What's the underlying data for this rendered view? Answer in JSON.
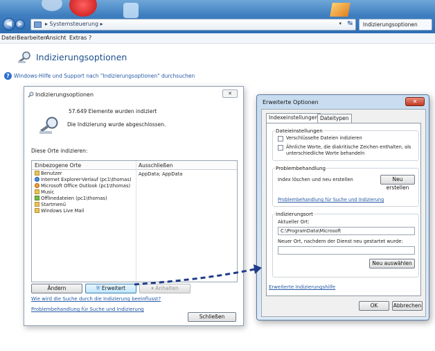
{
  "window": {
    "address_crumb": "▸ Systemsteuerung ▸",
    "search_text": "Indizierungsoptionen"
  },
  "menubar": {
    "items": [
      "Datei",
      "Bearbeiten",
      "Ansicht",
      "Extras",
      "?"
    ]
  },
  "page": {
    "heading": "Indizierungsoptionen",
    "help_link": "Windows-Hilfe und Support nach \"Indizierungsoptionen\" durchsuchen"
  },
  "dialog_indexing": {
    "title": "Indizierungsoptionen",
    "close_label": "✕",
    "count_text": "57.649 Elemente wurden indiziert",
    "status_text": "Die Indizierung wurde abgeschlossen.",
    "locations_label": "Diese Orte indizieren:",
    "col_included": "Einbezogene Orte",
    "col_excluded": "Ausschließen",
    "rows": [
      {
        "icon": "folder-icon",
        "label": "Benutzer",
        "excluded": "AppData; AppData"
      },
      {
        "icon": "internet-explorer-icon",
        "label": "Internet Explorer-Verlauf (pc1\\thomas)"
      },
      {
        "icon": "outlook-icon",
        "label": "Microsoft Office Outlook (pc1\\thomas)"
      },
      {
        "icon": "folder-icon",
        "label": "Music"
      },
      {
        "icon": "sync-icon",
        "label": "Offlinedateien (pc1\\thomas)"
      },
      {
        "icon": "folder-icon",
        "label": "Startmenü"
      },
      {
        "icon": "folder-icon",
        "label": "Windows Live Mail"
      }
    ],
    "btn_change": "Ändern",
    "btn_advanced": "Erweitert",
    "btn_pause": "Anhalten",
    "link_search_influence": "Wie wird die Suche durch die Indizierung beeinflusst?",
    "link_troubleshoot": "Problembehandlung für Suche und Indizierung",
    "btn_close": "Schließen"
  },
  "dialog_advanced": {
    "title": "Erweiterte Optionen",
    "close_label": "✕",
    "tabs": [
      "Indexeinstellungen",
      "Dateitypen"
    ],
    "group_file_settings": "Dateieinstellungen",
    "chk_encrypted": "Verschlüsselte Dateien indizieren",
    "chk_diacritics": "Ähnliche Worte, die diakritische Zeichen enthalten, als unterschiedliche Worte behandeln",
    "group_troubleshoot": "Problembehandlung",
    "rebuild_text": "Index löschen und neu erstellen",
    "btn_rebuild": "Neu erstellen",
    "link_troubleshoot": "Problembehandlung für Suche und Indizierung",
    "group_location": "Indizierungsort",
    "current_location_label": "Aktueller Ort:",
    "current_location_value": "C:\\ProgramData\\Microsoft",
    "new_location_label": "Neuer Ort, nachdem der Dienst neu gestartet wurde:",
    "new_location_value": "",
    "btn_select_new": "Neu auswählen",
    "link_help": "Erweiterte Indizierungshilfe",
    "btn_ok": "OK",
    "btn_cancel": "Abbrechen"
  },
  "colors": {
    "accent_blue": "#2559a5",
    "arrow": "#1f3a8a"
  }
}
